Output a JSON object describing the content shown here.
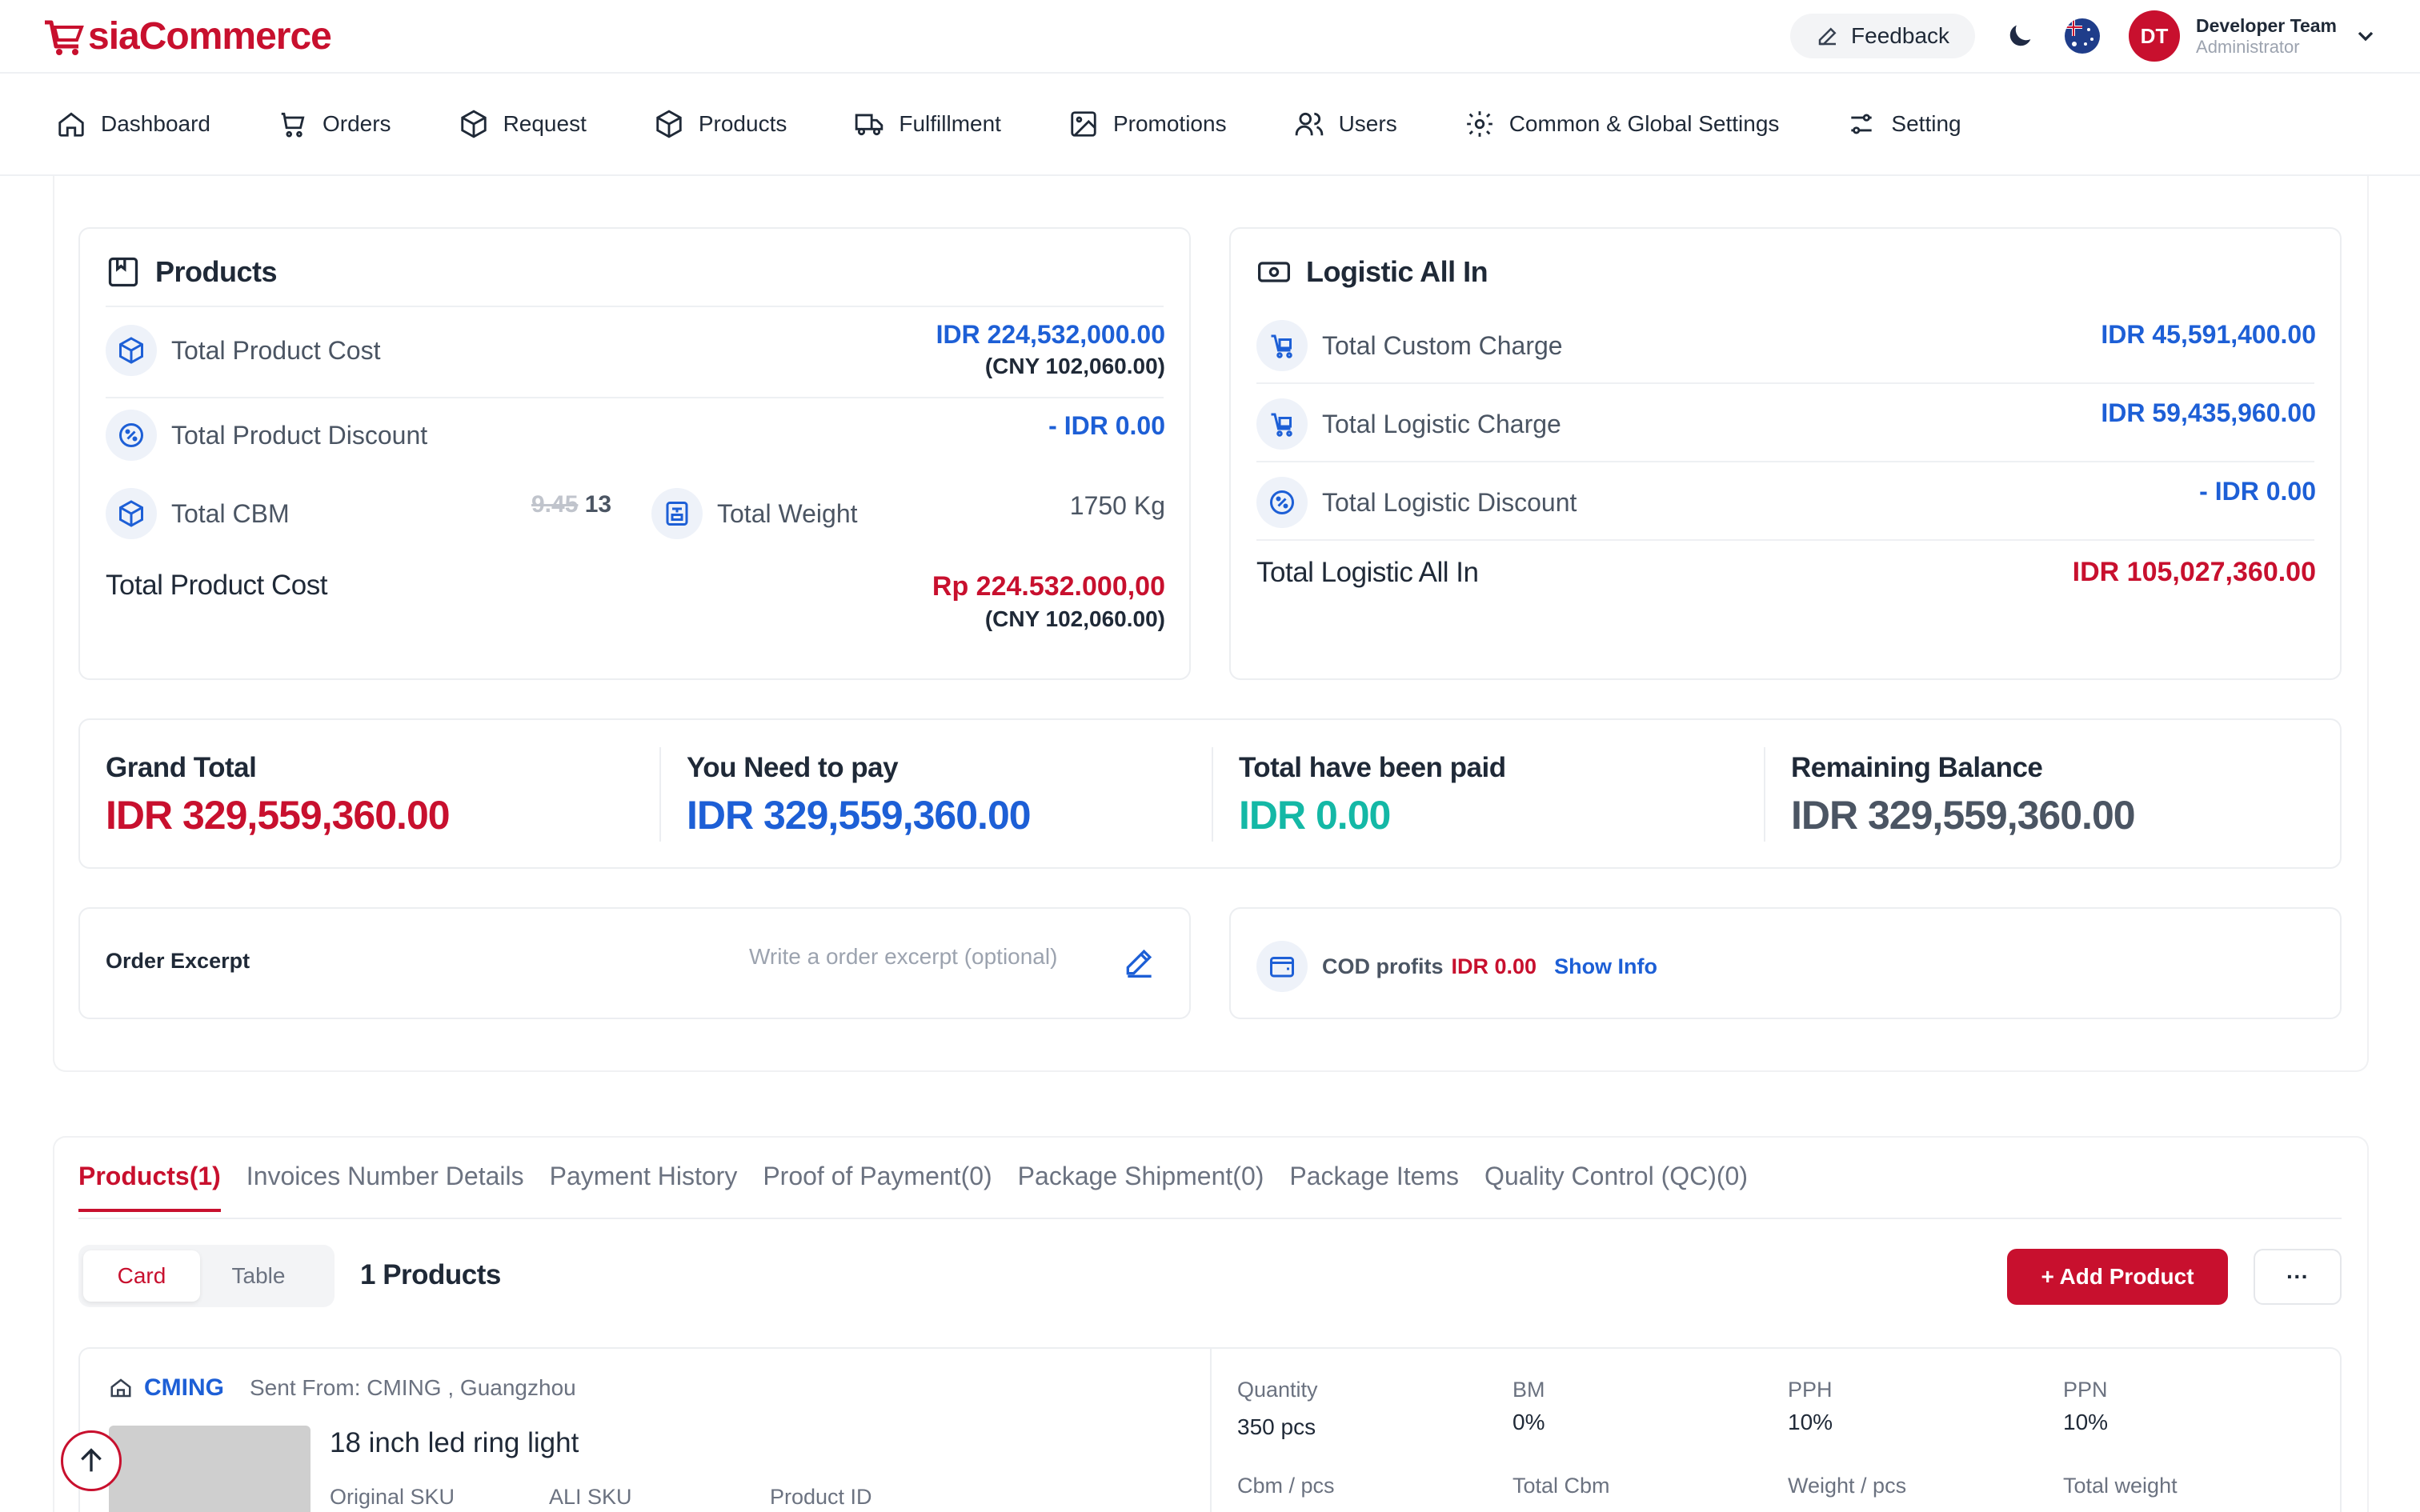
{
  "app": {
    "logo_a": "A",
    "logo_rest": "siaCommerce"
  },
  "header": {
    "feedback_label": "Feedback",
    "avatar_initials": "DT",
    "user_name": "Developer Team",
    "user_role": "Administrator"
  },
  "nav": {
    "items": [
      {
        "label": "Dashboard",
        "icon": "home-icon"
      },
      {
        "label": "Orders",
        "icon": "cart-icon"
      },
      {
        "label": "Request",
        "icon": "box-icon"
      },
      {
        "label": "Products",
        "icon": "box-icon"
      },
      {
        "label": "Fulfillment",
        "icon": "truck-icon"
      },
      {
        "label": "Promotions",
        "icon": "image-icon"
      },
      {
        "label": "Users",
        "icon": "users-icon"
      },
      {
        "label": "Common & Global Settings",
        "icon": "gear-icon"
      },
      {
        "label": "Setting",
        "icon": "sliders-icon"
      }
    ]
  },
  "products_panel": {
    "title": "Products",
    "total_product_cost_label": "Total Product Cost",
    "total_product_cost_idr": "IDR 224,532,000.00",
    "total_product_cost_cny": "(CNY 102,060.00)",
    "total_product_discount_label": "Total Product Discount",
    "total_product_discount_value": "- IDR 0.00",
    "total_cbm_label": "Total CBM",
    "total_cbm_old": "9.45",
    "total_cbm_new": "13",
    "total_weight_label": "Total Weight",
    "total_weight_value": "1750 Kg",
    "summary_label": "Total Product Cost",
    "summary_rp": "Rp 224.532.000,00",
    "summary_cny": "(CNY 102,060.00)"
  },
  "logistic_panel": {
    "title": "Logistic All In",
    "custom_charge_label": "Total Custom Charge",
    "custom_charge_value": "IDR 45,591,400.00",
    "logistic_charge_label": "Total Logistic Charge",
    "logistic_charge_value": "IDR 59,435,960.00",
    "logistic_discount_label": "Total Logistic Discount",
    "logistic_discount_value": "- IDR 0.00",
    "summary_label": "Total Logistic All In",
    "summary_value": "IDR 105,027,360.00"
  },
  "totals": {
    "grand_total_label": "Grand Total",
    "grand_total_value": "IDR 329,559,360.00",
    "need_to_pay_label": "You Need to pay",
    "need_to_pay_value": "IDR 329,559,360.00",
    "paid_label": "Total have been paid",
    "paid_value": "IDR 0.00",
    "remaining_label": "Remaining Balance",
    "remaining_value": "IDR 329,559,360.00"
  },
  "excerpt": {
    "label": "Order Excerpt",
    "placeholder": "Write a order excerpt (optional)"
  },
  "cod": {
    "label": "COD profits",
    "value": "IDR 0.00",
    "show_info": "Show Info"
  },
  "tabs": [
    {
      "label": "Products(1)",
      "active": true
    },
    {
      "label": "Invoices Number Details",
      "active": false
    },
    {
      "label": "Payment History",
      "active": false
    },
    {
      "label": "Proof of Payment(0)",
      "active": false
    },
    {
      "label": "Package Shipment(0)",
      "active": false
    },
    {
      "label": "Package Items",
      "active": false
    },
    {
      "label": "Quality Control (QC)(0)",
      "active": false
    }
  ],
  "view_toggle": {
    "card_label": "Card",
    "table_label": "Table"
  },
  "product_count": "1 Products",
  "add_product_label": "+ Add Product",
  "more_label": "···",
  "item": {
    "supplier": "CMING",
    "sent_from": "Sent From: CMING , Guangzhou",
    "title": "18 inch led ring light",
    "original_sku_label": "Original SKU",
    "ali_sku_label": "ALI SKU",
    "product_id_label": "Product ID",
    "specs": [
      {
        "label": "Quantity",
        "value": "350 pcs"
      },
      {
        "label": "BM",
        "value": "0%"
      },
      {
        "label": "PPH",
        "value": "10%"
      },
      {
        "label": "PPN",
        "value": "10%"
      },
      {
        "label": "Cbm / pcs",
        "value": ""
      },
      {
        "label": "Total Cbm",
        "value": ""
      },
      {
        "label": "Weight / pcs",
        "value": ""
      },
      {
        "label": "Total weight",
        "value": ""
      }
    ]
  },
  "colors": {
    "brand_red": "#c8102e",
    "blue": "#1d5fd6",
    "green": "#14b8a6"
  }
}
